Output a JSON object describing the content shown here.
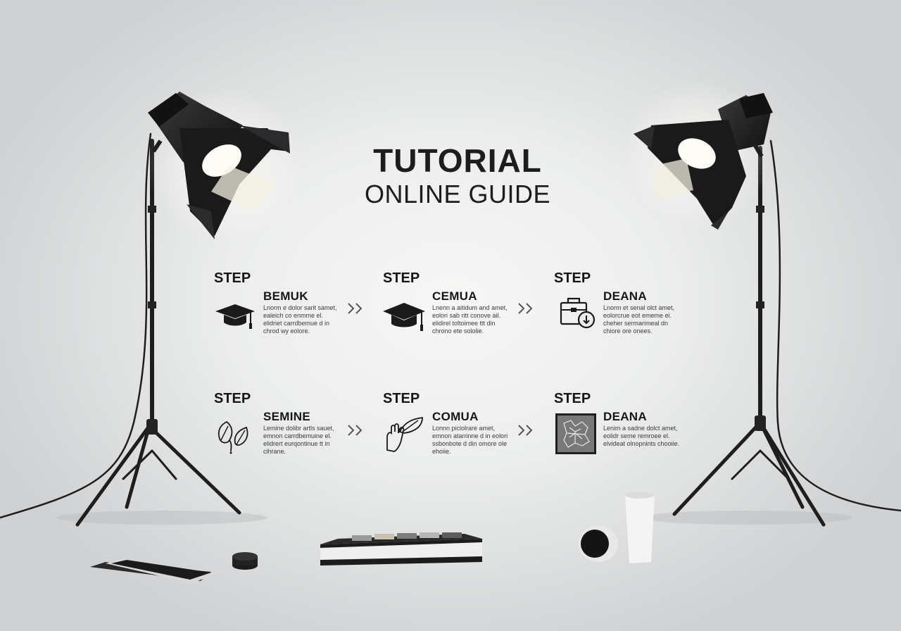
{
  "header": {
    "title": "TUTORIAL",
    "subtitle": "ONLINE GUIDE"
  },
  "steps": [
    {
      "label": "STEP",
      "name": "BEMUK",
      "icon": "graduation-cap-icon",
      "description": "Lnorm e dolor sarit samet, ealeich co enmme el. elidriet carrdbemue d in chrod wy eolore."
    },
    {
      "label": "STEP",
      "name": "CEMUA",
      "icon": "graduation-cap-icon",
      "description": "Lnenn a aitidum and amet, eolori sab ritt conove ail. elidirel toltoimee ttt din chrono ete sololie."
    },
    {
      "label": "STEP",
      "name": "DEANA",
      "icon": "briefcase-download-icon",
      "description": "Lnorm et senal olct amet, eolorcrue eot ememe ei. cheher sermarimeal dn chiore ore onees."
    },
    {
      "label": "STEP",
      "name": "SEMINE",
      "icon": "leaves-icon",
      "description": "Lemine dolibr artls sauet, emnon carrdbemuine el. elidrert eurqontinue tt in cihrane."
    },
    {
      "label": "STEP",
      "name": "COMUA",
      "icon": "hand-holding-leaf-icon",
      "description": "Lonnn piciolrare amet, emnon atarrinne d in eolori ssbonbote d din omore ole ehoiie."
    },
    {
      "label": "STEP",
      "name": "DEANA",
      "icon": "texture-tile-icon",
      "description": "Lenim a sadne dolct amet, eolidr seme remroee el. elvideat olnopnints chooiie."
    }
  ],
  "colors": {
    "text": "#161616",
    "lamp": "#1c1c1e",
    "background": "#ececec"
  }
}
